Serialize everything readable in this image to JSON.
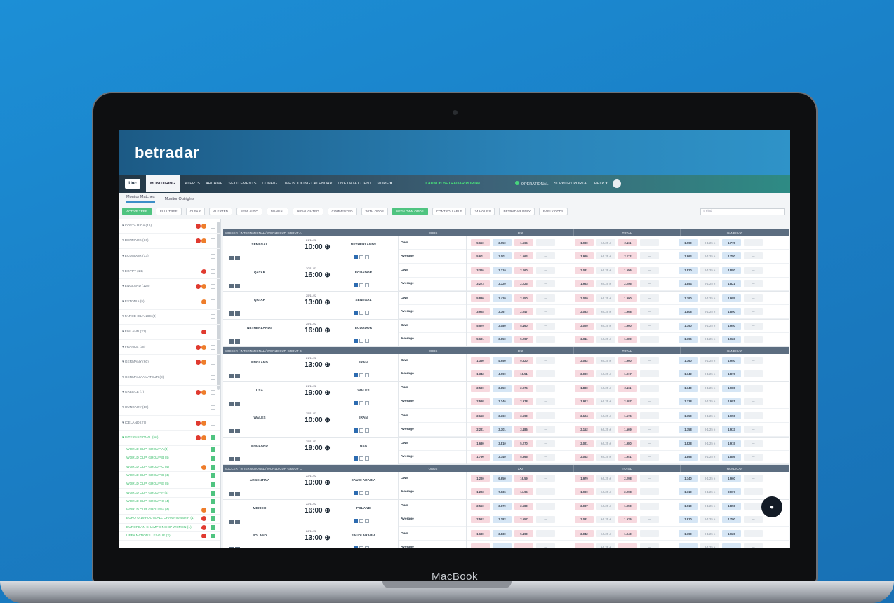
{
  "device": {
    "label": "MacBook"
  },
  "brand": {
    "logo": "betradar"
  },
  "nav": {
    "icon_label": "Uoc",
    "tabs": [
      "MONITORING",
      "ALERTS",
      "ARCHIVE",
      "SETTLEMENTS",
      "CONFIG",
      "LIVE BOOKING CALENDAR",
      "LIVE DATA CLIENT",
      "MORE ▾"
    ],
    "launch": "LAUNCH BETRADAR PORTAL",
    "status": "OPERATIONAL",
    "support": "SUPPORT PORTAL",
    "help": "HELP ▾"
  },
  "subtabs": [
    "Monitor Matches",
    "Monitor Outrights"
  ],
  "filters": [
    "ACTIVE TREE",
    "FULL TREE",
    "CLEAR",
    "ALERTED",
    "SEMI AUTO",
    "MANUAL",
    "HIGHLIGHTED",
    "COMMENTED",
    "WITH ODDS",
    "WITH OWN ODDS",
    "CONTROLLABLE",
    "24 HOURS",
    "BETRADAR ONLY",
    "EARLY ODDS"
  ],
  "search": {
    "placeholder": "Find"
  },
  "sidebar": [
    {
      "label": "COSTA RICA (16)",
      "b": [
        "r",
        "o"
      ]
    },
    {
      "label": "DENMARK (16)",
      "b": [
        "r",
        "o"
      ]
    },
    {
      "label": "ECUADOR (13)",
      "b": []
    },
    {
      "label": "EGYPT (14)",
      "b": [
        "r"
      ]
    },
    {
      "label": "ENGLAND (128)",
      "b": [
        "r",
        "o"
      ]
    },
    {
      "label": "ESTONIA (5)",
      "b": [
        "o"
      ]
    },
    {
      "label": "FAROE ISLANDS (3)",
      "b": []
    },
    {
      "label": "FINLAND (21)",
      "b": [
        "r"
      ]
    },
    {
      "label": "FRANCE (38)",
      "b": [
        "r",
        "o"
      ]
    },
    {
      "label": "GERMANY (60)",
      "b": [
        "r",
        "o"
      ]
    },
    {
      "label": "GERMANY AMATEUR (8)",
      "b": []
    },
    {
      "label": "GREECE (7)",
      "b": [
        "r",
        "o"
      ]
    },
    {
      "label": "HUNGARY (10)",
      "b": []
    },
    {
      "label": "ICELAND (27)",
      "b": [
        "r",
        "o"
      ]
    },
    {
      "label": "INTERNATIONAL (56)",
      "b": [
        "r",
        "o"
      ],
      "green": true,
      "cb": true
    }
  ],
  "subitems": [
    {
      "label": "WORLD CUP, GROUP A (4)",
      "b": []
    },
    {
      "label": "WORLD CUP, GROUP B (4)",
      "b": []
    },
    {
      "label": "WORLD CUP, GROUP C (4)",
      "b": [
        "o"
      ]
    },
    {
      "label": "WORLD CUP, GROUP D (4)",
      "b": []
    },
    {
      "label": "WORLD CUP, GROUP E (4)",
      "b": []
    },
    {
      "label": "WORLD CUP, GROUP F (4)",
      "b": []
    },
    {
      "label": "WORLD CUP, GROUP G (4)",
      "b": []
    },
    {
      "label": "WORLD CUP, GROUP H (4)",
      "b": [
        "o"
      ]
    },
    {
      "label": "EURO U-19 FOOTBALL CHAMPIONSHIP (1)",
      "b": [
        "r"
      ]
    },
    {
      "label": "EUROPEAN CHAMPIONSHIP WOMEN (1)",
      "b": [
        "r"
      ]
    },
    {
      "label": "UEFA NATIONS LEAGUE (2)",
      "b": [
        "r"
      ]
    }
  ],
  "columns": {
    "odds": "ODDS",
    "tg": "1X2",
    "total": "TOTAL",
    "handicap": "HANDICAP"
  },
  "groups": [
    {
      "title": "SOCCER / INTERNATIONAL / WORLD CUP, GROUP A",
      "matches": [
        {
          "home": "SENEGAL",
          "away": "NETHERLANDS",
          "date": "21/11/22",
          "time": "10:00"
        },
        {
          "home": "QATAR",
          "away": "ECUADOR",
          "date": "20/11/22",
          "time": "16:00"
        },
        {
          "home": "QATAR",
          "away": "SENEGAL",
          "date": "25/11/22",
          "time": "13:00"
        },
        {
          "home": "NETHERLANDS",
          "away": "ECUADOR",
          "date": "25/11/22",
          "time": "16:00"
        }
      ]
    },
    {
      "title": "SOCCER / INTERNATIONAL / WORLD CUP, GROUP B",
      "matches": [
        {
          "home": "ENGLAND",
          "away": "IRAN",
          "date": "21/11/22",
          "time": "13:00"
        },
        {
          "home": "USA",
          "away": "WALES",
          "date": "21/11/22",
          "time": "19:00"
        },
        {
          "home": "WALES",
          "away": "IRAN",
          "date": "25/11/22",
          "time": "10:00"
        },
        {
          "home": "ENGLAND",
          "away": "USA",
          "date": "25/11/22",
          "time": "19:00"
        }
      ]
    },
    {
      "title": "SOCCER / INTERNATIONAL / WORLD CUP, GROUP C",
      "matches": [
        {
          "home": "ARGENTINA",
          "away": "SAUDI ARABIA",
          "date": "22/11/22",
          "time": "10:00"
        },
        {
          "home": "MEXICO",
          "away": "POLAND",
          "date": "22/11/22",
          "time": "16:00"
        },
        {
          "home": "POLAND",
          "away": "SAUDI ARABIA",
          "date": "26/11/22",
          "time": "13:00"
        }
      ]
    }
  ],
  "row_labels": {
    "own": "Own",
    "average": "Average"
  },
  "odds_rows": [
    [
      "5.650",
      "3.950",
      "1.665",
      "1.980",
      "2.111",
      "1.990",
      "1.770"
    ],
    [
      "5.601",
      "3.001",
      "1.664",
      "1.995",
      "2.112",
      "1.964",
      "1.750"
    ],
    [
      "3.326",
      "3.310",
      "2.260",
      "2.031",
      "1.556",
      "1.820",
      "1.880"
    ],
    [
      "3.273",
      "3.320",
      "2.223",
      "1.953",
      "2.256",
      "1.854",
      "1.821"
    ],
    [
      "5.880",
      "3.420",
      "2.050",
      "2.020",
      "1.990",
      "1.790",
      "1.985"
    ],
    [
      "3.928",
      "3.367",
      "2.047",
      "2.033",
      "1.968",
      "1.808",
      "1.890"
    ],
    [
      "5.570",
      "3.080",
      "5.460",
      "2.020",
      "1.960",
      "1.790",
      "1.950"
    ],
    [
      "5.601",
      "3.050",
      "5.297",
      "2.011",
      "1.989",
      "1.796",
      "1.923"
    ],
    [
      "1.350",
      "4.950",
      "9.320",
      "2.032",
      "1.960",
      "1.760",
      "1.950"
    ],
    [
      "1.343",
      "4.990",
      "10.51",
      "2.090",
      "1.917",
      "1.742",
      "1.876"
    ],
    [
      "2.590",
      "3.150",
      "2.975",
      "1.880",
      "2.111",
      "1.740",
      "1.980"
    ],
    [
      "2.598",
      "3.146",
      "2.978",
      "1.912",
      "2.097",
      "1.738",
      "1.981"
    ],
    [
      "2.158",
      "3.360",
      "3.690",
      "2.124",
      "1.576",
      "1.750",
      "1.950"
    ],
    [
      "2.221",
      "3.301",
      "3.486",
      "2.152",
      "1.569",
      "1.758",
      "1.933"
    ],
    [
      "1.680",
      "3.810",
      "5.270",
      "2.021",
      "1.980",
      "1.828",
      "1.915"
    ],
    [
      "1.790",
      "3.740",
      "5.365",
      "2.052",
      "1.951",
      "1.898",
      "1.886"
    ],
    [
      "1.220",
      "6.650",
      "16.59",
      "1.970",
      "2.298",
      "1.740",
      "1.960"
    ],
    [
      "1.223",
      "7.036",
      "14.95",
      "1.990",
      "2.298",
      "1.719",
      "2.007"
    ],
    [
      "2.550",
      "3.170",
      "2.680",
      "2.087",
      "1.950",
      "1.910",
      "1.850"
    ],
    [
      "2.562",
      "3.182",
      "2.657",
      "2.081",
      "1.525",
      "1.910",
      "1.790"
    ],
    [
      "1.680",
      "3.830",
      "5.490",
      "2.042",
      "1.940",
      "1.790",
      "1.920"
    ]
  ],
  "spreads": {
    "total": "±2.25 ±",
    "handicap": "0-1.25 ±"
  }
}
